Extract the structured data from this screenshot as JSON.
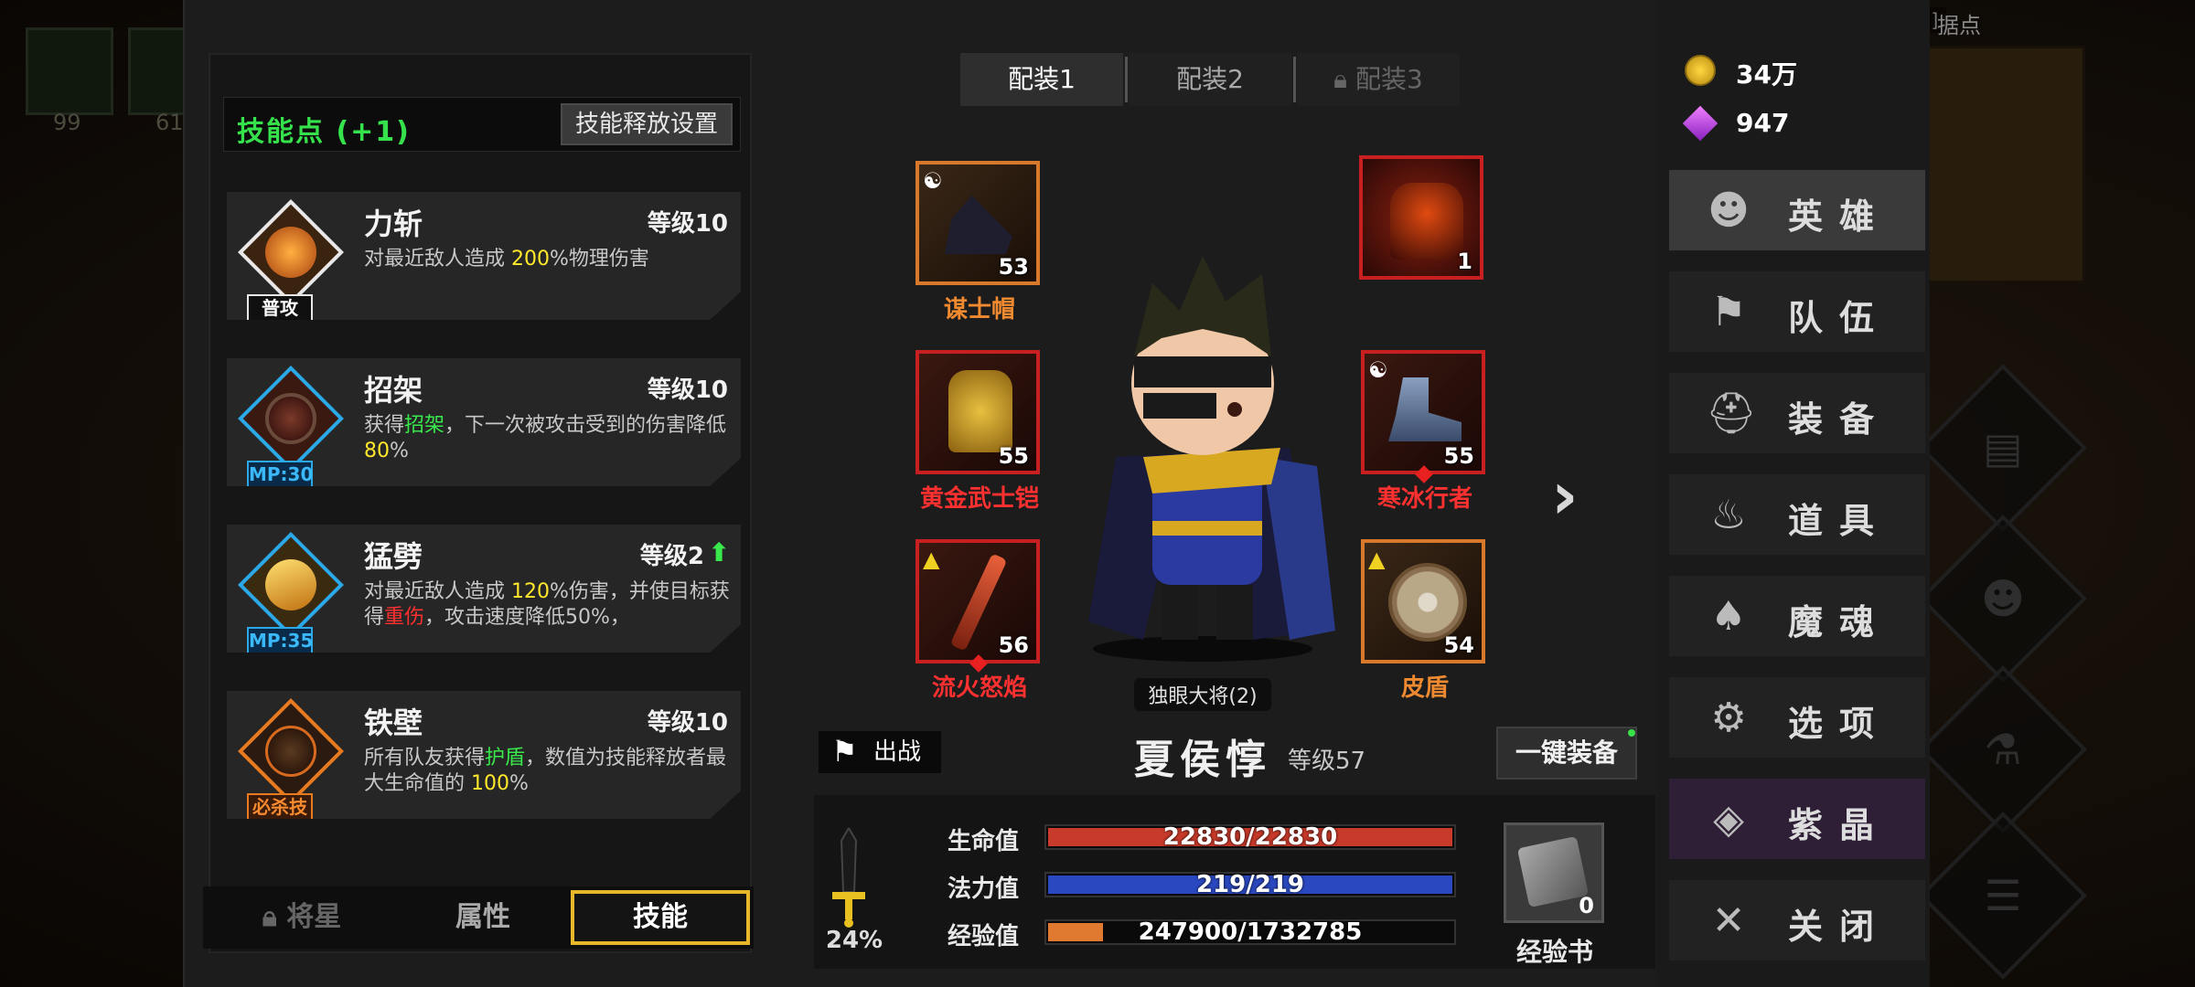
{
  "session_id": "[e374f323-8bb2-4c4c-bdfd]",
  "bg_top_label": "据点",
  "bg_counts": [
    "99",
    "61"
  ],
  "skill_panel": {
    "title": "技能点 (+1)",
    "release_settings": "技能释放设置",
    "skills": [
      {
        "name": "力斩",
        "level": "等级10",
        "tag": "普攻",
        "desc_parts": [
          "对最近敌人造成 ",
          "200",
          "%物理伤害"
        ]
      },
      {
        "name": "招架",
        "level": "等级10",
        "tag": "MP:30",
        "desc_parts": [
          "获得",
          "招架",
          "，下一次被攻击受到的伤害降低 ",
          "80",
          "%"
        ]
      },
      {
        "name": "猛劈",
        "level": "等级2",
        "tag": "MP:35",
        "desc_parts": [
          "对最近敌人造成 ",
          "120",
          "%伤害，并使目标获得",
          "重伤",
          "，攻击速度降低50%，"
        ]
      },
      {
        "name": "铁壁",
        "level": "等级10",
        "tag": "必杀技",
        "desc_parts": [
          "所有队友获得",
          "护盾",
          "，数值为技能释放者最大生命值的 ",
          "100",
          "%"
        ]
      }
    ],
    "tabs": {
      "star": "将星",
      "attr": "属性",
      "skill": "技能"
    }
  },
  "loadout_tabs": [
    "配装1",
    "配装2",
    "配装3"
  ],
  "equipment": [
    {
      "name": "谋士帽",
      "level": "53"
    },
    {
      "name": "",
      "level": "1"
    },
    {
      "name": "黄金武士铠",
      "level": "55"
    },
    {
      "name": "寒冰行者",
      "level": "55"
    },
    {
      "name": "流火怒焰",
      "level": "56"
    },
    {
      "name": "皮盾",
      "level": "54"
    }
  ],
  "hero": {
    "title": "独眼大将(2)",
    "name": "夏侯惇",
    "level": "等级57",
    "battle": "出战",
    "equip_all": "一键装备"
  },
  "stats": {
    "hp_label": "生命值",
    "hp_text": "22830/22830",
    "hp_ratio": 1.0,
    "mp_label": "法力值",
    "mp_text": "219/219",
    "mp_ratio": 1.0,
    "exp_label": "经验值",
    "exp_text": "247900/1732785",
    "exp_ratio": 0.143,
    "power_pct": "24%",
    "exp_book_label": "经验书",
    "exp_book_count": "0"
  },
  "currency": {
    "gold": "34万",
    "gems": "947"
  },
  "menu": [
    "英雄",
    "队伍",
    "装备",
    "道具",
    "魔魂",
    "选项",
    "紫晶",
    "关闭"
  ],
  "colors": {
    "hp": "#c83a2a",
    "mp": "#2a48c0",
    "exp": "#e07a30",
    "accent": "#e8b82a",
    "green": "#36e24c"
  }
}
